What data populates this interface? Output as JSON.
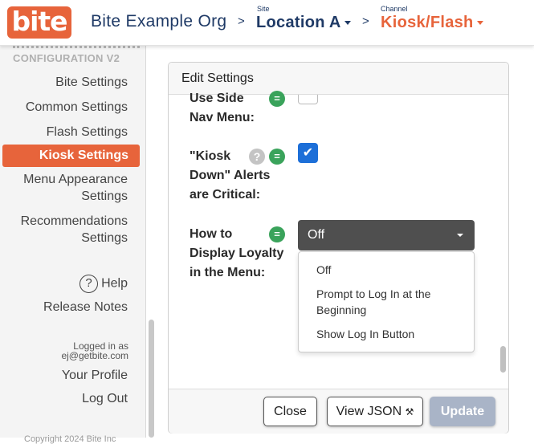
{
  "header": {
    "logo_text": "bite",
    "org_name": "Bite Example Org",
    "separator": ">",
    "site": {
      "small_label": "Site",
      "value": "Location A"
    },
    "channel": {
      "small_label": "Channel",
      "value": "Kiosk/Flash"
    },
    "colors": {
      "brand": "#e7643b",
      "navy": "#1f3a66"
    }
  },
  "sidebar": {
    "heading": "CONFIGURATION V2",
    "items": [
      {
        "label": "Bite Settings",
        "active": false
      },
      {
        "label": "Common Settings",
        "active": false
      },
      {
        "label": "Flash Settings",
        "active": false
      },
      {
        "label": "Kiosk Settings",
        "active": true
      },
      {
        "label": "Menu Appearance Settings",
        "active": false
      },
      {
        "label": "Recommendations Settings",
        "active": false
      }
    ],
    "help_label": "Help",
    "help_icon": "?",
    "release_notes": "Release Notes",
    "logged_in_as": "Logged in as",
    "email": "ej@getbite.com",
    "profile": "Your Profile",
    "logout": "Log Out",
    "copyright": "Copyright 2024 Bite Inc"
  },
  "modal": {
    "title": "Edit Settings",
    "settings": [
      {
        "label_lines": [
          "Use Side",
          "Nav Menu:"
        ],
        "badge": "=",
        "checked": false
      },
      {
        "label_lines": [
          "\"Kiosk",
          "Down\" Alerts",
          "are Critical:"
        ],
        "badge": "=",
        "help": "?",
        "checked": true
      },
      {
        "label_lines": [
          "How to",
          "Display Loyalty",
          "in the Menu:"
        ],
        "badge": "="
      }
    ],
    "loyalty_select": {
      "selected": "Off",
      "options": [
        "Off",
        "Prompt to Log In at the Beginning",
        "Show Log In Button"
      ]
    },
    "checkmark": "✔",
    "buttons": {
      "close": "Close",
      "view_json": "View JSON",
      "view_json_icon": "⚒",
      "update": "Update"
    }
  }
}
